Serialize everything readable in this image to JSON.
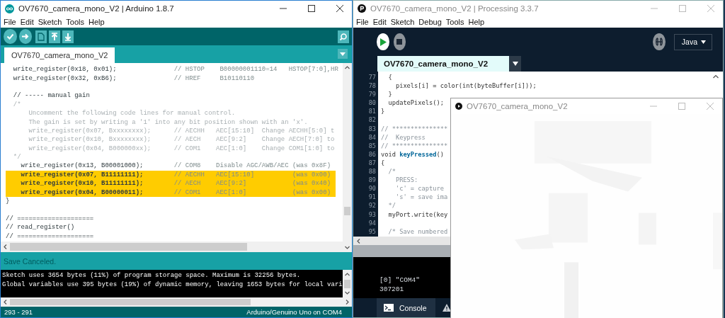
{
  "arduino": {
    "title": "OV7670_camera_mono_V2 | Arduino 1.8.7",
    "menu": [
      "File",
      "Edit",
      "Sketch",
      "Tools",
      "Help"
    ],
    "tabs": [
      {
        "label": "OV7670_camera_mono_V2",
        "selected": true
      }
    ],
    "code_lines": [
      {
        "kind": "code",
        "code": "  write_register(0x18, 0x01);",
        "note": "// HSTOP    B00000001110=14   HSTOP[7:0],HR"
      },
      {
        "kind": "code",
        "code": "  write_register(0x32, 0xB6);",
        "note": "// HREF     B10110110"
      },
      {
        "kind": "blank"
      },
      {
        "kind": "code",
        "code": "  // ----- manual gain"
      },
      {
        "kind": "comment",
        "code": "  /*"
      },
      {
        "kind": "comment",
        "code": "      Uncomment the following code lines for manual control."
      },
      {
        "kind": "comment",
        "code": "      The gain is set by writing a '1' into any bit position shown with an 'x'."
      },
      {
        "kind": "comment",
        "code": "      write_register(0x07, Bxxxxxxxx);",
        "note": "// AECHH   AEC[15:10]  Change AECHH[5:0] t"
      },
      {
        "kind": "comment",
        "code": "      write_register(0x10, Bxxxxxxxx);",
        "note": "// AECH    AEC[9:2]    Change AECH[7:0] to"
      },
      {
        "kind": "comment",
        "code": "      write_register(0x04, B000000xx);",
        "note": "// COM1    AEC[1:0]    Change COM1[1:0] to"
      },
      {
        "kind": "comment",
        "code": "  */"
      },
      {
        "kind": "code",
        "code": "    write_register(0x13, B00001000);",
        "note": "// COM8    Disable AGC/AWB/AEC (was 0x8F)"
      },
      {
        "kind": "highlight",
        "code": "    write_register(0x07, B11111111);",
        "note": "// AECHH   AEC[15:10]          (was 0x00)"
      },
      {
        "kind": "highlight",
        "code": "    write_register(0x10, B11111111);",
        "note": "// AECH    AEC[9:2]            (was 0x40)"
      },
      {
        "kind": "highlight",
        "code": "    write_register(0x04, B00000011);",
        "note": "// COM1    AEC[1:0]            (was 0x00)"
      },
      {
        "kind": "code",
        "code": "}"
      },
      {
        "kind": "blank"
      },
      {
        "kind": "code",
        "code": "// ===================="
      },
      {
        "kind": "code",
        "code": "// read_register()"
      },
      {
        "kind": "code",
        "code": "// ===================="
      }
    ],
    "status": "Save Canceled.",
    "console": [
      "Sketch uses 3654 bytes (11%) of program storage space. Maximum is 32256 bytes.",
      "Global variables use 395 bytes (19%) of dynamic memory, leaving 1653 bytes for local vari"
    ],
    "footer": {
      "position": "293 - 291",
      "board": "Arduino/Genuino Uno on COM4"
    }
  },
  "processing": {
    "title": "OV7670_camera_mono_V2 | Processing 3.3.7",
    "menu": [
      "File",
      "Edit",
      "Sketch",
      "Debug",
      "Tools",
      "Help"
    ],
    "mode": "Java",
    "tabs": [
      {
        "label": "OV7670_camera_mono_V2",
        "selected": true
      }
    ],
    "code_lines": [
      {
        "number": "77",
        "kind": "code",
        "text": "  {"
      },
      {
        "number": "78",
        "kind": "code",
        "text": "    pixels[i] = color(int(byteBuffer[i]));"
      },
      {
        "number": "79",
        "kind": "code",
        "text": "  }"
      },
      {
        "number": "80",
        "kind": "code",
        "text": "  updatePixels();"
      },
      {
        "number": "81",
        "kind": "code",
        "text": "}"
      },
      {
        "number": "82",
        "kind": "blank"
      },
      {
        "number": "83",
        "kind": "comment",
        "text": "// ***************"
      },
      {
        "number": "84",
        "kind": "comment",
        "text": "//  Keypress"
      },
      {
        "number": "85",
        "kind": "comment",
        "text": "// ***************"
      },
      {
        "number": "86",
        "kind": "markup",
        "text": "void **keyPressed**()"
      },
      {
        "number": "87",
        "kind": "code",
        "text": "{"
      },
      {
        "number": "88",
        "kind": "comment",
        "text": "  /*"
      },
      {
        "number": "89",
        "kind": "comment",
        "text": "    PRESS:"
      },
      {
        "number": "90",
        "kind": "comment",
        "text": "    'c' = capture"
      },
      {
        "number": "91",
        "kind": "comment",
        "text": "    's' = save ima"
      },
      {
        "number": "92",
        "kind": "comment",
        "text": "  */"
      },
      {
        "number": "93",
        "kind": "code",
        "text": "  myPort.write(key"
      },
      {
        "number": "94",
        "kind": "blank"
      },
      {
        "number": "95",
        "kind": "comment",
        "text": "  /* Save numbered"
      }
    ],
    "console": [
      "[0] \"COM4\"",
      "307201"
    ],
    "console_tab": "Console"
  },
  "sketch_window": {
    "title": "OV7670_camera_mono_V2"
  }
}
